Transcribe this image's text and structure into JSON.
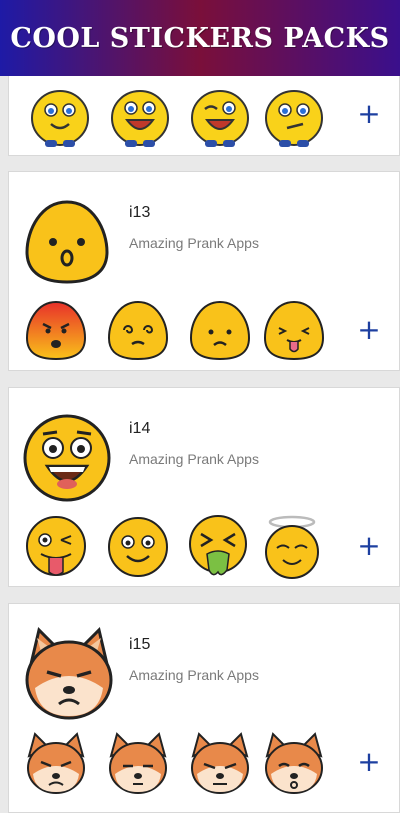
{
  "header": {
    "title": "COOL STICKERS PACKS"
  },
  "packs": [
    {
      "name": "",
      "author": "",
      "add_label": "+",
      "stickers": [
        "smile-eyes-sticker",
        "laugh-sticker",
        "wink-laugh-sticker",
        "skeptical-sticker"
      ]
    },
    {
      "name": "i13",
      "author": "Amazing Prank Apps",
      "add_label": "+",
      "tray": "surprised-blob-sticker",
      "stickers": [
        "angry-blob-sticker",
        "dizzy-blob-sticker",
        "sad-blob-sticker",
        "tongue-blob-sticker"
      ]
    },
    {
      "name": "i14",
      "author": "Amazing Prank Apps",
      "add_label": "+",
      "tray": "shocked-laugh-sticker",
      "stickers": [
        "crazy-tongue-sticker",
        "smile-sticker",
        "sick-sticker",
        "angel-sticker"
      ]
    },
    {
      "name": "i15",
      "author": "Amazing Prank Apps",
      "add_label": "+",
      "tray": "shiba-grumpy-sticker",
      "stickers": [
        "shiba-angry-sticker",
        "shiba-sleepy-sticker",
        "shiba-annoyed-sticker",
        "shiba-kiss-sticker"
      ]
    }
  ],
  "colors": {
    "accent": "#1d3fa0",
    "emoji_yellow": "#f9c21a",
    "shiba": "#e8894a"
  }
}
